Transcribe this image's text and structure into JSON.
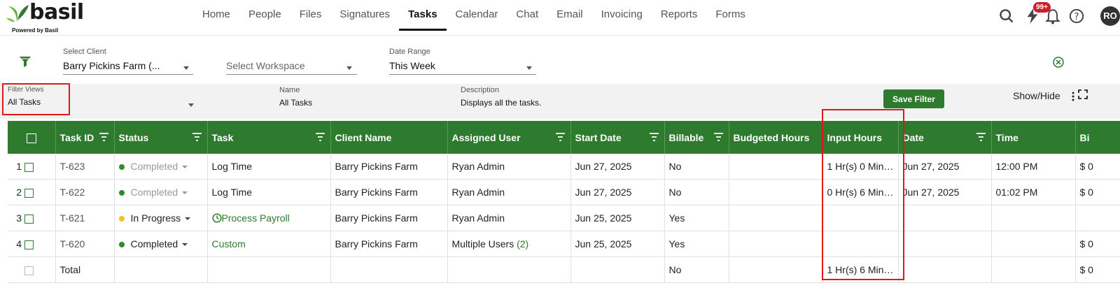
{
  "app": {
    "logo_text": "basil",
    "logo_subtext": "Powered by Basil"
  },
  "nav": {
    "items": [
      {
        "label": "Home"
      },
      {
        "label": "People"
      },
      {
        "label": "Files"
      },
      {
        "label": "Signatures"
      },
      {
        "label": "Tasks",
        "active": true
      },
      {
        "label": "Calendar"
      },
      {
        "label": "Chat"
      },
      {
        "label": "Email"
      },
      {
        "label": "Invoicing"
      },
      {
        "label": "Reports"
      },
      {
        "label": "Forms"
      }
    ],
    "notifications_badge": "99+",
    "avatar_initials": "RO",
    "icons": [
      "search-icon",
      "lightning-icon",
      "bell-icon",
      "help-icon"
    ]
  },
  "filters": {
    "client_label": "Select Client",
    "client_value": "Barry Pickins Farm (...",
    "workspace_placeholder": "Select Workspace",
    "date_range_label": "Date Range",
    "date_range_value": "This Week",
    "filter_views_label": "Filter Views",
    "filter_views_value": "All Tasks",
    "name_label": "Name",
    "name_value": "All Tasks",
    "description_label": "Description",
    "description_value": "Displays all the tasks.",
    "save_filter_label": "Save Filter",
    "show_hide_label": "Show/Hide"
  },
  "colors": {
    "brand_green": "#2e7a2e",
    "highlight_red": "#e0181b",
    "status_completed": "#2e8b2e",
    "status_in_progress": "#f2c12e"
  },
  "table": {
    "columns": [
      "Task ID",
      "Status",
      "Task",
      "Client Name",
      "Assigned User",
      "Start Date",
      "Billable",
      "Budgeted Hours",
      "Input Hours",
      "Date",
      "Time",
      "Bi"
    ],
    "rows": [
      {
        "num": "1",
        "task_id": "T-623",
        "status": "Completed",
        "status_dim": true,
        "task": "Log Time",
        "client": "Barry Pickins Farm",
        "user": "Ryan Admin",
        "start_date": "Jun 27, 2025",
        "billable": "No",
        "budgeted": "",
        "input_hours": "1 Hr(s) 0 Min(...",
        "date": "Jun 27, 2025",
        "time": "12:00 PM",
        "bi": "$ 0"
      },
      {
        "num": "2",
        "task_id": "T-622",
        "status": "Completed",
        "status_dim": true,
        "task": "Log Time",
        "client": "Barry Pickins Farm",
        "user": "Ryan Admin",
        "start_date": "Jun 27, 2025",
        "billable": "No",
        "budgeted": "",
        "input_hours": "0 Hr(s) 6 Min(...",
        "date": "Jun 27, 2025",
        "time": "01:02 PM",
        "bi": "$ 0"
      },
      {
        "num": "3",
        "task_id": "T-621",
        "status": "In Progress",
        "status_dim": false,
        "task": "Process Payroll",
        "client": "Barry Pickins Farm",
        "user": "Ryan Admin",
        "start_date": "Jun 25, 2025",
        "billable": "Yes",
        "budgeted": "",
        "input_hours": "",
        "date": "",
        "time": "",
        "bi": ""
      },
      {
        "num": "4",
        "task_id": "T-620",
        "status": "Completed",
        "status_dim": false,
        "task": "Custom",
        "client": "Barry Pickins Farm",
        "user": "Multiple Users",
        "user_count": "(2)",
        "start_date": "Jun 25, 2025",
        "billable": "Yes",
        "budgeted": "",
        "input_hours": "",
        "date": "",
        "time": "",
        "bi": "$ 0"
      }
    ],
    "total": {
      "label": "Total",
      "billable": "No",
      "input_hours": "1 Hr(s) 6 Min(...",
      "bi": "$ 0"
    }
  }
}
